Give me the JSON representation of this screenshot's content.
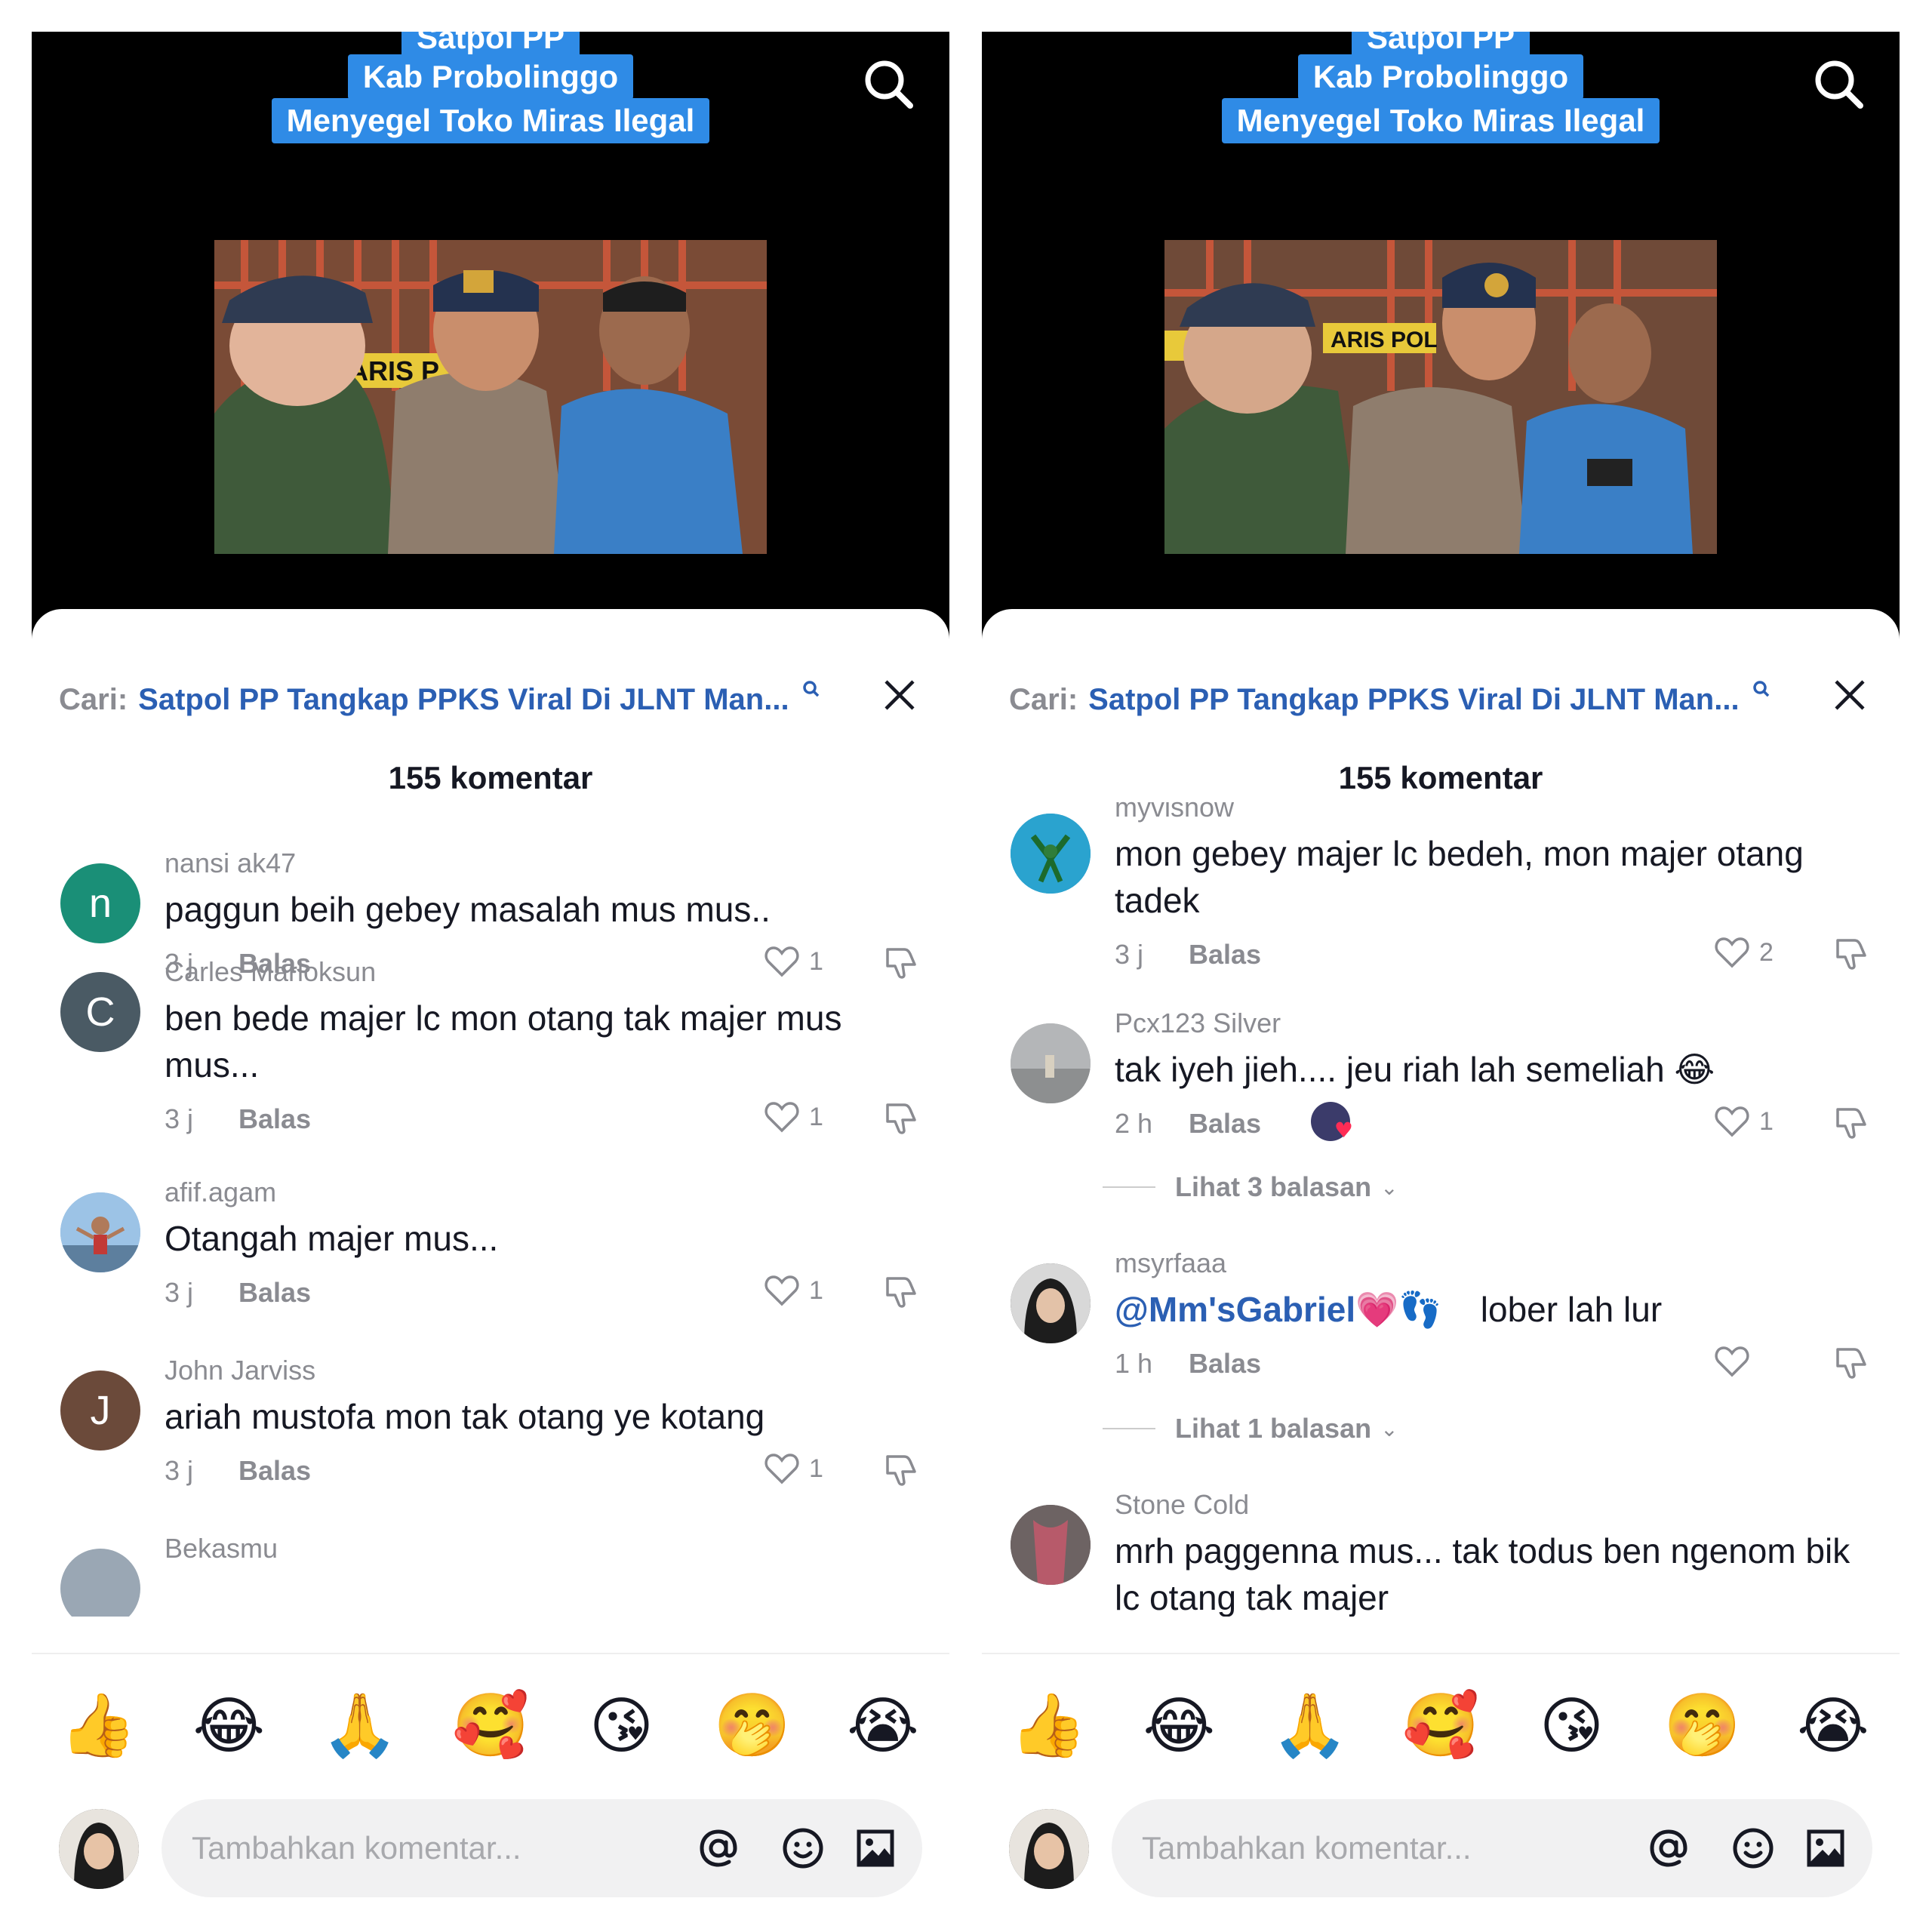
{
  "caption": {
    "line1": "Satpol PP",
    "line2": "Kab  Probolinggo",
    "line3": "Menyegel Toko Miras Ilegal"
  },
  "sheet": {
    "search_prefix": "Cari:",
    "search_query": "Satpol PP Tangkap PPKS Viral Di JLNT Man...",
    "comment_count": "155 komentar"
  },
  "composer": {
    "placeholder": "Tambahkan komentar...",
    "emojis": [
      "👍",
      "😂",
      "🙏",
      "🥰",
      "😘",
      "🤭",
      "😭"
    ]
  },
  "left_comments": [
    {
      "user": "nansi ak47",
      "initial": "n",
      "avatar_color": "#1a8f77",
      "text": "paggun beih gebey masalah mus mus..",
      "time": "3 j",
      "reply": "Balas",
      "likes": "1"
    },
    {
      "user": "Carles Marloksun",
      "initial": "C",
      "avatar_color": "#4a5a64",
      "text": "ben bede majer lc mon otang tak majer mus mus...",
      "time": "3 j",
      "reply": "Balas",
      "likes": "1"
    },
    {
      "user": "afif.agam",
      "initial": "",
      "avatar_color": "#8fb6d8",
      "text": "Otangah majer mus...",
      "time": "3 j",
      "reply": "Balas",
      "likes": "1"
    },
    {
      "user": "John Jarviss",
      "initial": "J",
      "avatar_color": "#6b4a3a",
      "text": "ariah mustofa mon tak otang ye kotang",
      "time": "3 j",
      "reply": "Balas",
      "likes": "1"
    },
    {
      "user": "Bekasmu",
      "initial": "",
      "avatar_color": "#9aa7b4",
      "text": "",
      "time": "",
      "reply": "",
      "likes": ""
    }
  ],
  "right_comments": [
    {
      "user": "myvisnow",
      "text": "mon gebey majer lc bedeh, mon majer otang tadek",
      "time": "3 j",
      "reply": "Balas",
      "likes": "2"
    },
    {
      "user": "Pcx123 Silver",
      "text": "tak iyeh jieh.... jeu riah lah semeliah 😂",
      "time": "2 h",
      "reply": "Balas",
      "likes": "1",
      "replies": "Lihat 3 balasan"
    },
    {
      "user": "msyrfaaa",
      "mention": "@Mm'sGabriel💗👣",
      "text": "lober lah lur",
      "time": "1 h",
      "reply": "Balas",
      "likes": "",
      "replies": "Lihat 1 balasan"
    },
    {
      "user": "Stone Cold",
      "text": "mrh paggenna mus... tak todus ben ngenom bik lc otang tak majer",
      "time": "",
      "reply": "",
      "likes": ""
    }
  ],
  "icons": {
    "search": "search-icon",
    "close": "close-icon",
    "like": "heart-icon",
    "dislike": "thumbs-down-icon",
    "mention": "at-icon",
    "emoji": "smiley-icon",
    "image": "image-icon"
  }
}
